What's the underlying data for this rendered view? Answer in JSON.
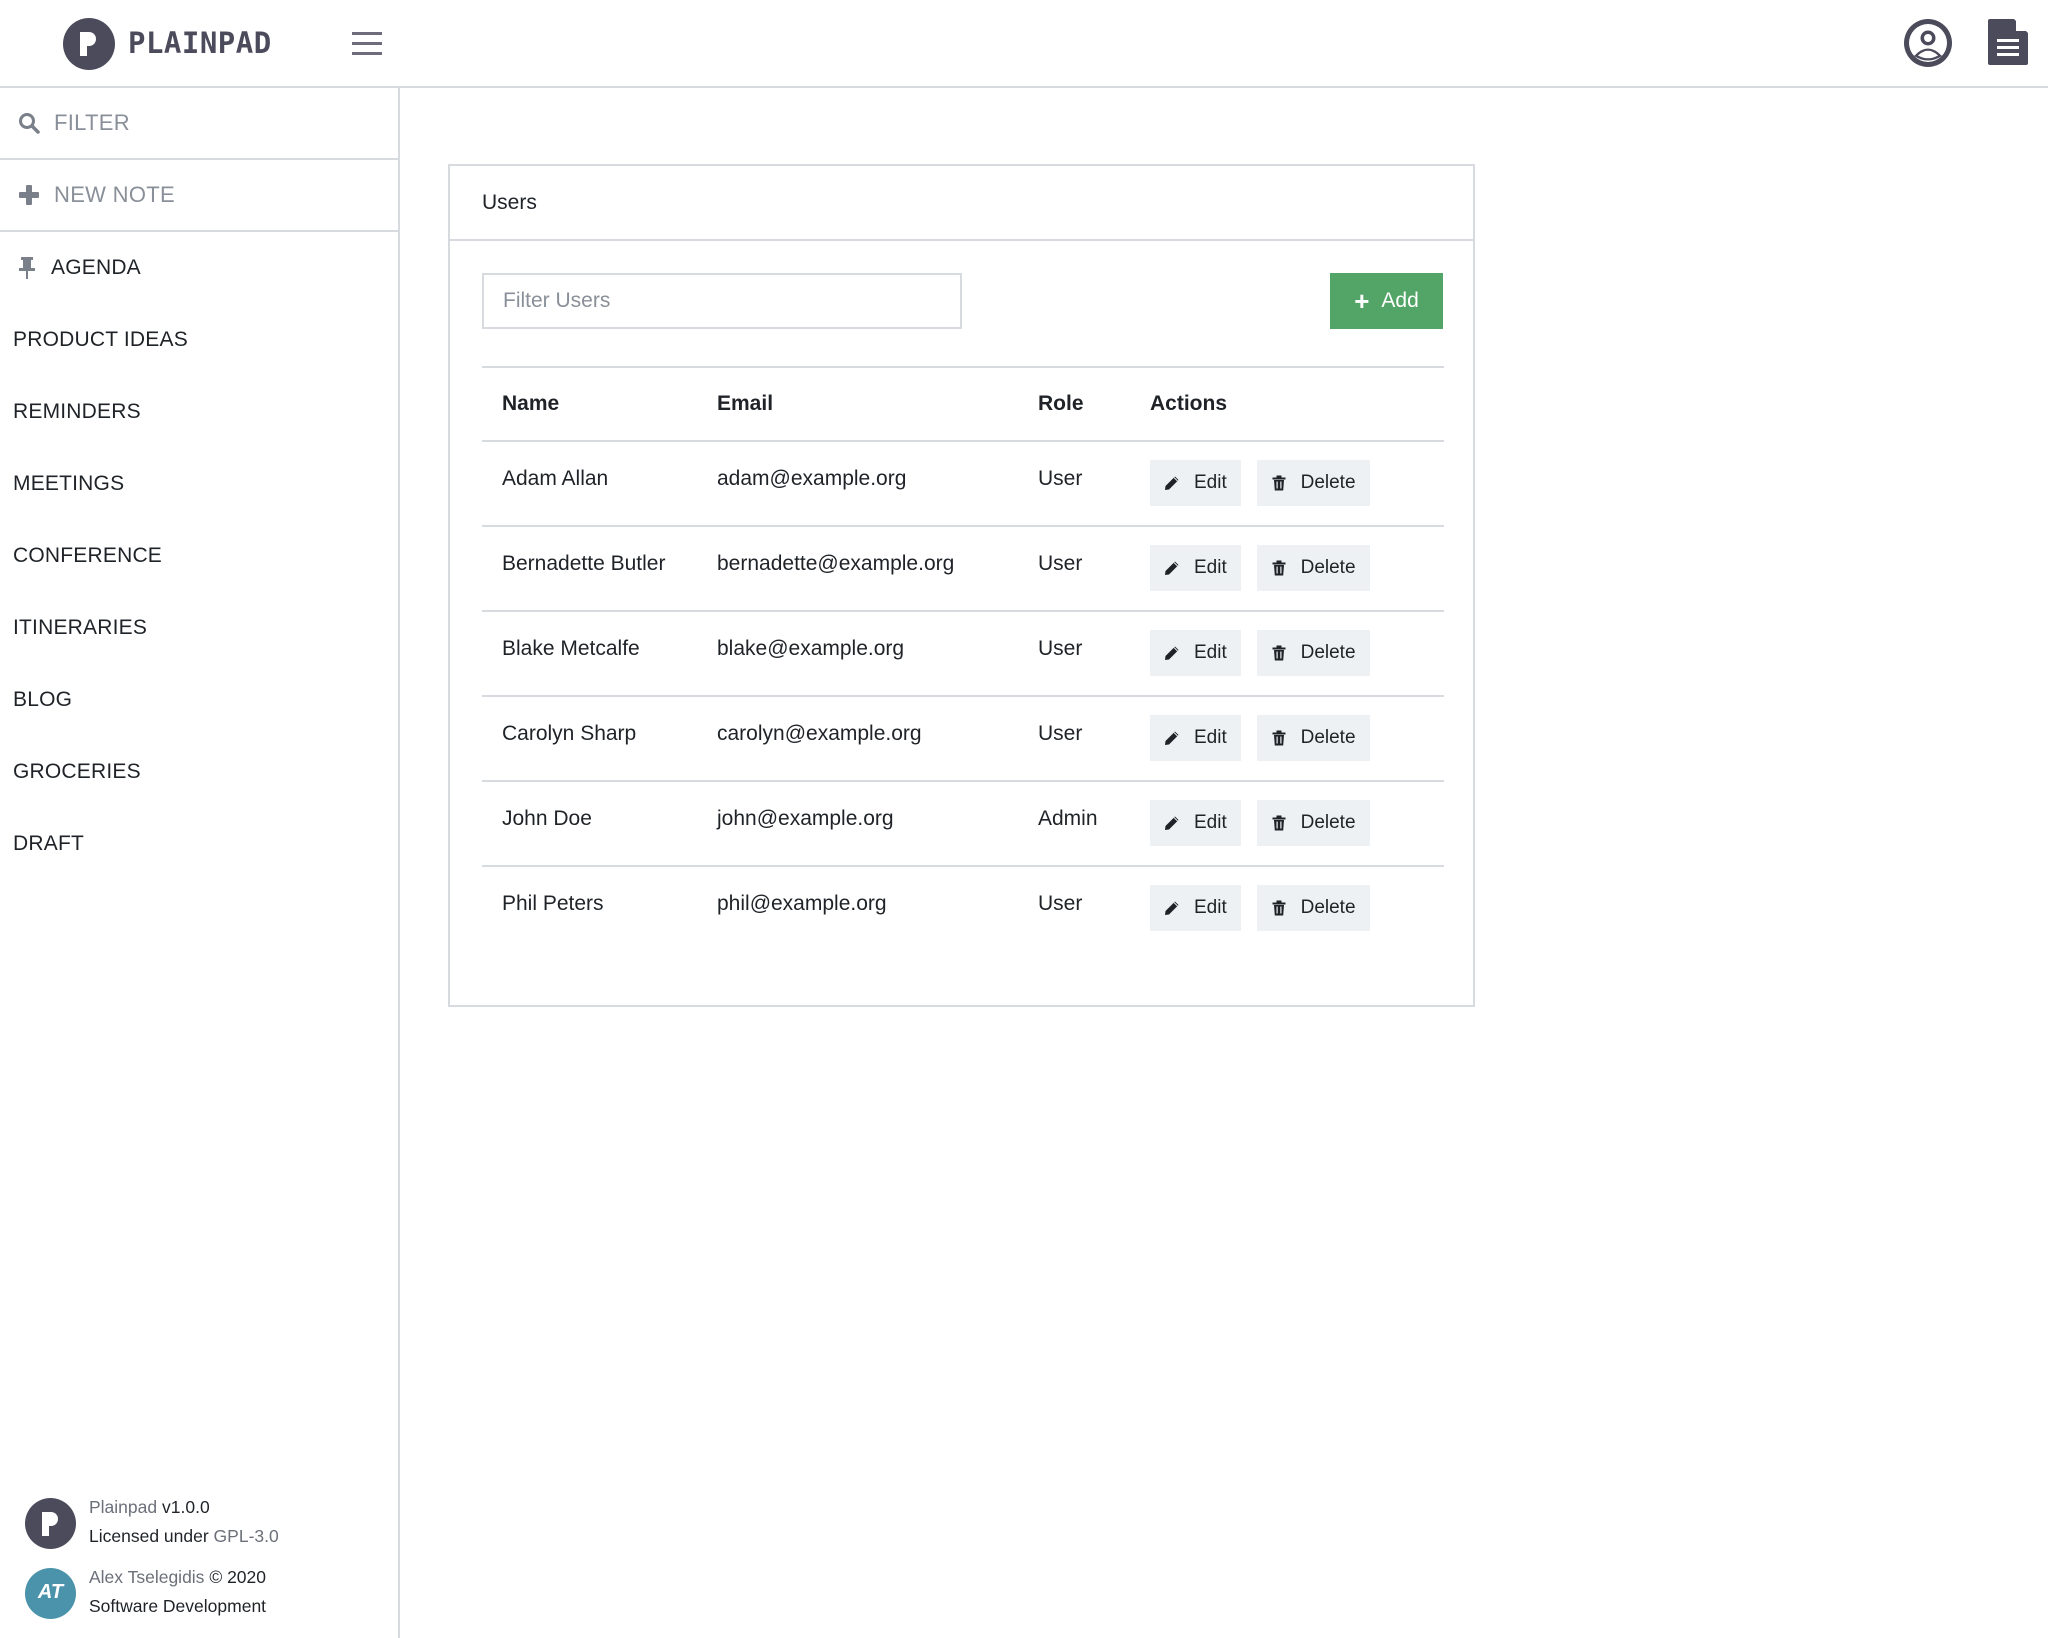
{
  "header": {
    "brand": "PLAINPAD",
    "menu_icon": "hamburger-icon",
    "user_icon": "user-circle-icon",
    "document_icon": "document-icon"
  },
  "sidebar": {
    "filter_label": "FILTER",
    "filter_icon": "search-icon",
    "new_note_label": "NEW NOTE",
    "new_note_icon": "plus-icon",
    "notes": [
      {
        "label": "AGENDA",
        "pinned": true
      },
      {
        "label": "PRODUCT IDEAS",
        "pinned": false
      },
      {
        "label": "REMINDERS",
        "pinned": false
      },
      {
        "label": "MEETINGS",
        "pinned": false
      },
      {
        "label": "CONFERENCE",
        "pinned": false
      },
      {
        "label": "ITINERARIES",
        "pinned": false
      },
      {
        "label": "BLOG",
        "pinned": false
      },
      {
        "label": "GROCERIES",
        "pinned": false
      },
      {
        "label": "DRAFT",
        "pinned": false
      }
    ],
    "footer": {
      "app_name": "Plainpad",
      "version": "v1.0.0",
      "license_prefix": "Licensed under",
      "license": "GPL-3.0",
      "author": "Alex Tselegidis",
      "copyright": "© 2020",
      "company": "Software Development",
      "author_avatar_text": "AT"
    }
  },
  "users_panel": {
    "title": "Users",
    "filter_placeholder": "Filter Users",
    "filter_value": "",
    "add_label": "Add",
    "add_color": "#52a467",
    "columns": [
      "Name",
      "Email",
      "Role",
      "Actions"
    ],
    "edit_label": "Edit",
    "delete_label": "Delete",
    "rows": [
      {
        "name": "Adam Allan",
        "email": "adam@example.org",
        "role": "User"
      },
      {
        "name": "Bernadette Butler",
        "email": "bernadette@example.org",
        "role": "User"
      },
      {
        "name": "Blake Metcalfe",
        "email": "blake@example.org",
        "role": "User"
      },
      {
        "name": "Carolyn Sharp",
        "email": "carolyn@example.org",
        "role": "User"
      },
      {
        "name": "John Doe",
        "email": "john@example.org",
        "role": "Admin"
      },
      {
        "name": "Phil Peters",
        "email": "phil@example.org",
        "role": "User"
      }
    ]
  }
}
